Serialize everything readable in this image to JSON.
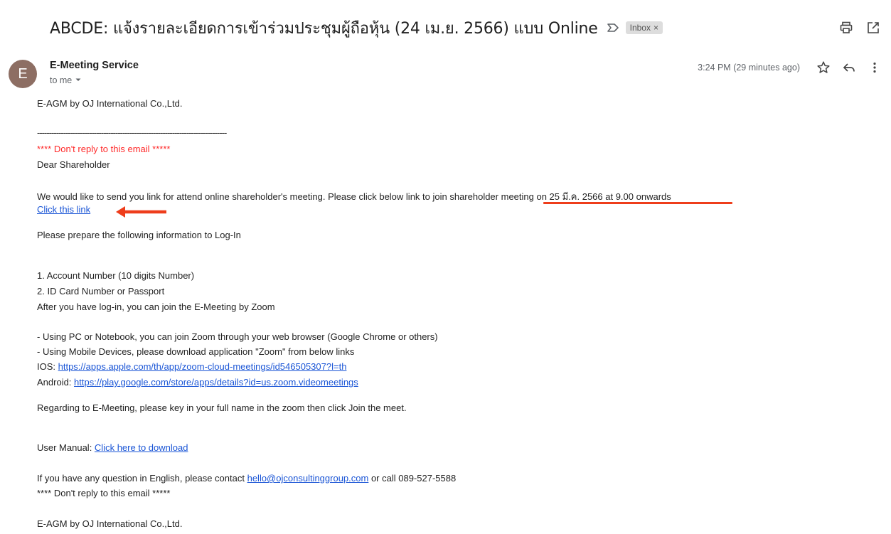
{
  "email": {
    "subject": "ABCDE: แจ้งรายละเอียดการเข้าร่วมประชุมผู้ถือหุ้น (24 เม.ย. 2566) แบบ Online",
    "label": "Inbox",
    "label_remove": "×",
    "sender_initial": "E",
    "sender_name": "E-Meeting Service",
    "recipient": "to me",
    "timestamp": "3:24 PM (29 minutes ago)",
    "avatar_color": "#8d6e63"
  },
  "icons": {
    "important": "important-marker-icon",
    "print": "print-icon",
    "open_new_window": "open-in-new-icon",
    "star": "star-icon",
    "reply": "reply-icon",
    "more": "more-vert-icon",
    "dropdown": "chevron-down-icon"
  },
  "body": {
    "company_top": "E-AGM by OJ International Co.,Ltd.",
    "separator": "--------------------------------------------------------------------------------",
    "no_reply_top": "**** Don't reply to this email *****",
    "greeting": "Dear Shareholder",
    "intro_part1": "We would like to send you link for attend online shareholder's meeting. Please click below link to join shareholder ",
    "intro_part2": "meeting on 25 มี.ค. 2566 at 9.00 onwards",
    "join_link": "Click this link",
    "prepare": "Please prepare the following information to Log-In",
    "item1": "1. Account Number (10 digits Number)",
    "item2": "2. ID Card Number or Passport",
    "after_login": "After you have log-in, you can join the E-Meeting by Zoom",
    "pc_note": "- Using PC or Notebook, you can join Zoom through your web browser (Google Chrome or others)",
    "mobile_note": "- Using Mobile Devices, please download application \"Zoom\" from below links",
    "ios_label": "IOS: ",
    "ios_link": "https://apps.apple.com/th/app/zoom-cloud-meetings/id546505307?l=th",
    "android_label": "Android: ",
    "android_link": "https://play.google.com/store/apps/details?id=us.zoom.videomeetings",
    "regarding": "Regarding to E-Meeting, please key in your full name in the zoom then click Join the meet.",
    "manual_label": "User Manual: ",
    "manual_link": "Click here to download",
    "question_part1": "If you have any question in English, please contact ",
    "question_email": "hello@ojconsultinggroup.com",
    "question_part2": " or call 089-527-5588",
    "no_reply_bottom": "**** Don't reply to this email *****",
    "company_bottom": "E-AGM by OJ International Co.,Ltd."
  },
  "colors": {
    "link": "#1a55d6",
    "warning_red": "#ff2a2a",
    "annotation": "#ee3d1b"
  }
}
